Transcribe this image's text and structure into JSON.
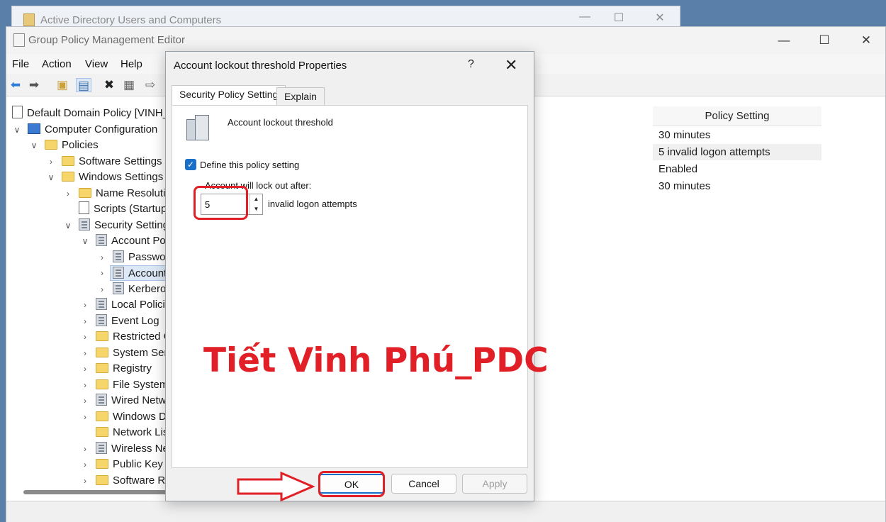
{
  "back_window": {
    "title": "Active Directory Users and Computers"
  },
  "main_window": {
    "title": "Group Policy Management Editor",
    "menu": [
      "File",
      "Action",
      "View",
      "Help"
    ]
  },
  "tree": {
    "items": [
      "Default Domain Policy [VINH_",
      "Computer Configuration",
      "Policies",
      "Software Settings",
      "Windows Settings",
      "Name Resolutic",
      "Scripts (Startup",
      "Security Setting",
      "Account Pol",
      "Passwor",
      "Account",
      "Kerbero",
      "Local Policie",
      "Event Log",
      "Restricted G",
      "System Serv",
      "Registry",
      "File System",
      "Wired Netw",
      "Windows D",
      "Network Lis",
      "Wireless Ne",
      "Public Key P",
      "Software Re"
    ]
  },
  "list": {
    "column_header": "Policy Setting",
    "rows": [
      "30 minutes",
      "5 invalid logon attempts",
      "Enabled",
      "30 minutes"
    ]
  },
  "dialog": {
    "title": "Account lockout threshold Properties",
    "help": "?",
    "tabs": [
      "Security Policy Setting",
      "Explain"
    ],
    "policy_name": "Account lockout threshold",
    "define_label": "Define this policy setting",
    "define_checked": true,
    "lockout_label": "Account will lock out after:",
    "lockout_value": "5",
    "unit_label": "invalid logon attempts",
    "buttons": {
      "ok": "OK",
      "cancel": "Cancel",
      "apply": "Apply"
    }
  },
  "watermark": "Tiết Vinh Phú_PDC",
  "colors": {
    "accent": "#1a6fc9",
    "highlight": "#e01f26"
  }
}
